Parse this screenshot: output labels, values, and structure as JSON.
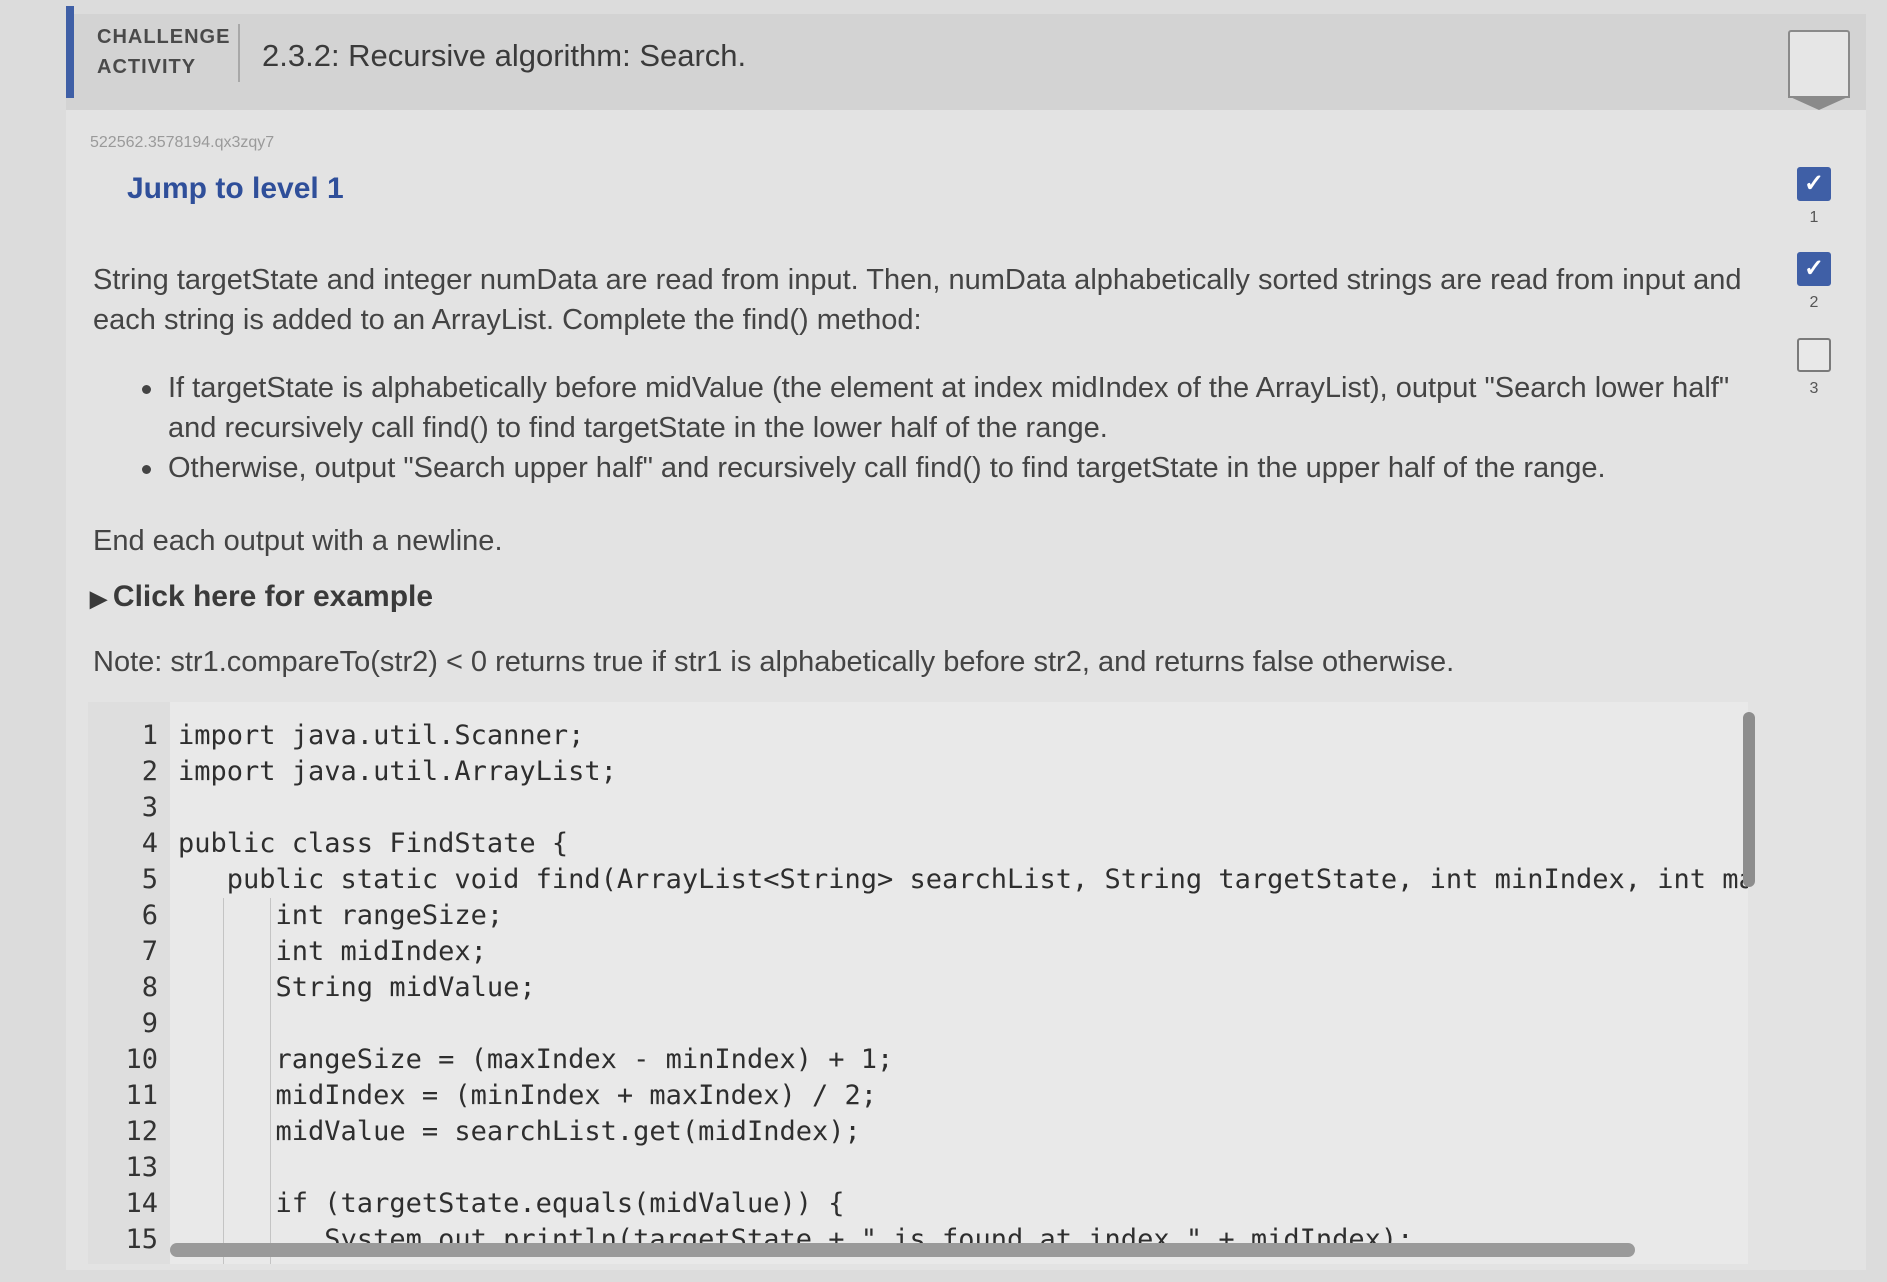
{
  "header": {
    "label_line1": "CHALLENGE",
    "label_line2": "ACTIVITY",
    "title": "2.3.2: Recursive algorithm: Search."
  },
  "activity_id": "522562.3578194.qx3zqy7",
  "jump_link": "Jump to level 1",
  "intro": "String targetState and integer numData are read from input. Then, numData alphabetically sorted strings are read from input and each string is added to an ArrayList. Complete the find() method:",
  "bullets": [
    "If targetState is alphabetically before midValue (the element at index midIndex of the ArrayList), output \"Search lower half\" and recursively call find() to find targetState in the lower half of the range.",
    "Otherwise, output \"Search upper half\" and recursively call find() to find targetState in the upper half of the range."
  ],
  "end_note": "End each output with a newline.",
  "example_toggle": "Click here for example",
  "note": "Note: str1.compareTo(str2) < 0 returns true if str1 is alphabetically before str2, and returns false otherwise.",
  "levels": [
    {
      "number": "1",
      "state": "completed",
      "mark": "✓"
    },
    {
      "number": "2",
      "state": "completed",
      "mark": "✓"
    },
    {
      "number": "3",
      "state": "pending",
      "mark": ""
    }
  ],
  "code": [
    {
      "n": "1",
      "text": "import java.util.Scanner;"
    },
    {
      "n": "2",
      "text": "import java.util.ArrayList;"
    },
    {
      "n": "3",
      "text": ""
    },
    {
      "n": "4",
      "text": "public class FindState {"
    },
    {
      "n": "5",
      "text": "   public static void find(ArrayList<String> searchList, String targetState, int minIndex, int maxIr"
    },
    {
      "n": "6",
      "text": "      int rangeSize;"
    },
    {
      "n": "7",
      "text": "      int midIndex;"
    },
    {
      "n": "8",
      "text": "      String midValue;"
    },
    {
      "n": "9",
      "text": ""
    },
    {
      "n": "10",
      "text": "      rangeSize = (maxIndex - minIndex) + 1;"
    },
    {
      "n": "11",
      "text": "      midIndex = (minIndex + maxIndex) / 2;"
    },
    {
      "n": "12",
      "text": "      midValue = searchList.get(midIndex);"
    },
    {
      "n": "13",
      "text": ""
    },
    {
      "n": "14",
      "text": "      if (targetState.equals(midValue)) {"
    },
    {
      "n": "15",
      "text": "         System.out.println(targetState + \" is found at index \" + midIndex);"
    }
  ],
  "colors": {
    "accent": "#3f5fa6",
    "link": "#2f4f9a"
  }
}
